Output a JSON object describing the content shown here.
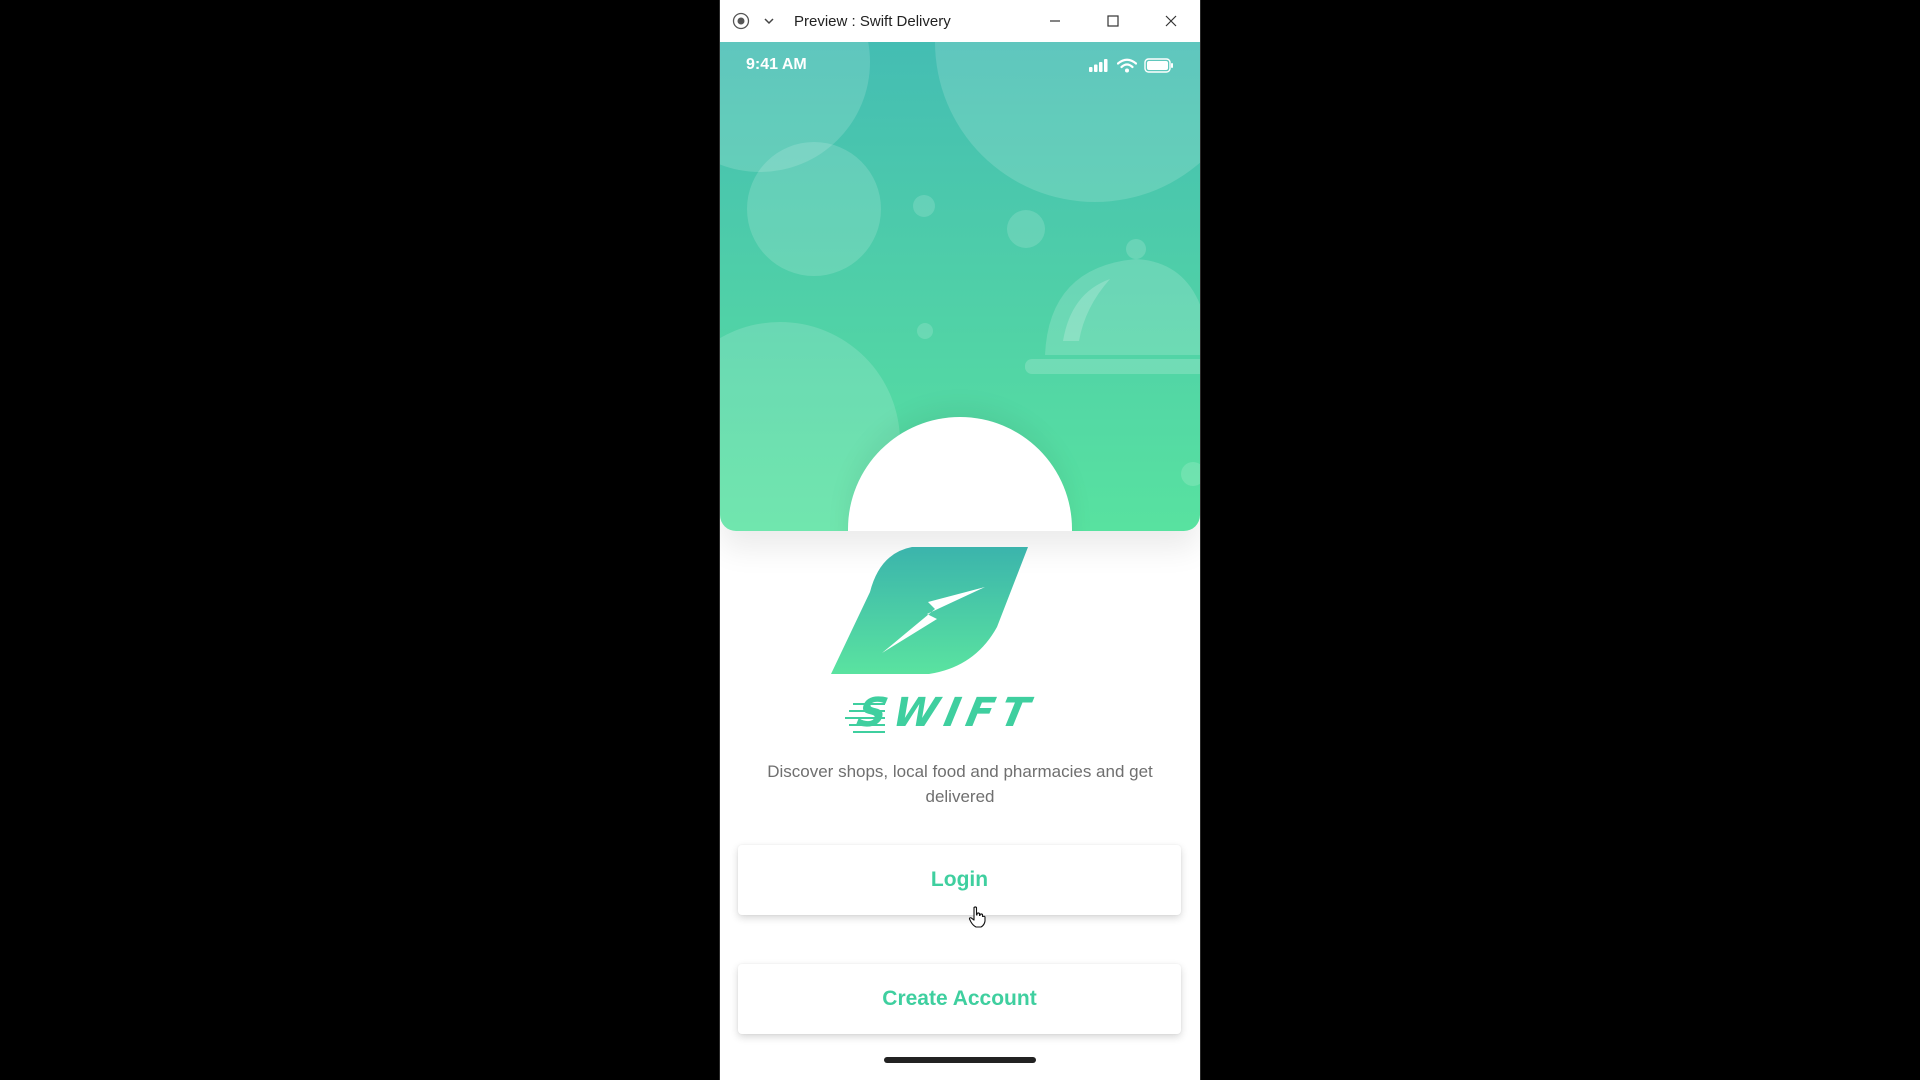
{
  "window": {
    "title": "Preview : Swift Delivery",
    "icons": [
      "record-icon",
      "chevron-down-icon",
      "minimize-icon",
      "maximize-icon",
      "close-icon"
    ]
  },
  "status_bar": {
    "time": "9:41 AM",
    "icons": [
      "signal-icon",
      "wifi-icon",
      "battery-icon"
    ]
  },
  "brand": {
    "name": "SWIFT",
    "tagline": "Discover shops, local food and pharmacies and get delivered"
  },
  "actions": {
    "login_label": "Login",
    "create_account_label": "Create Account"
  },
  "colors": {
    "gradient_top": "#44bdb3",
    "gradient_bottom": "#58e2a0",
    "accent": "#3fcf9f",
    "text_muted": "#6f6f6f"
  }
}
